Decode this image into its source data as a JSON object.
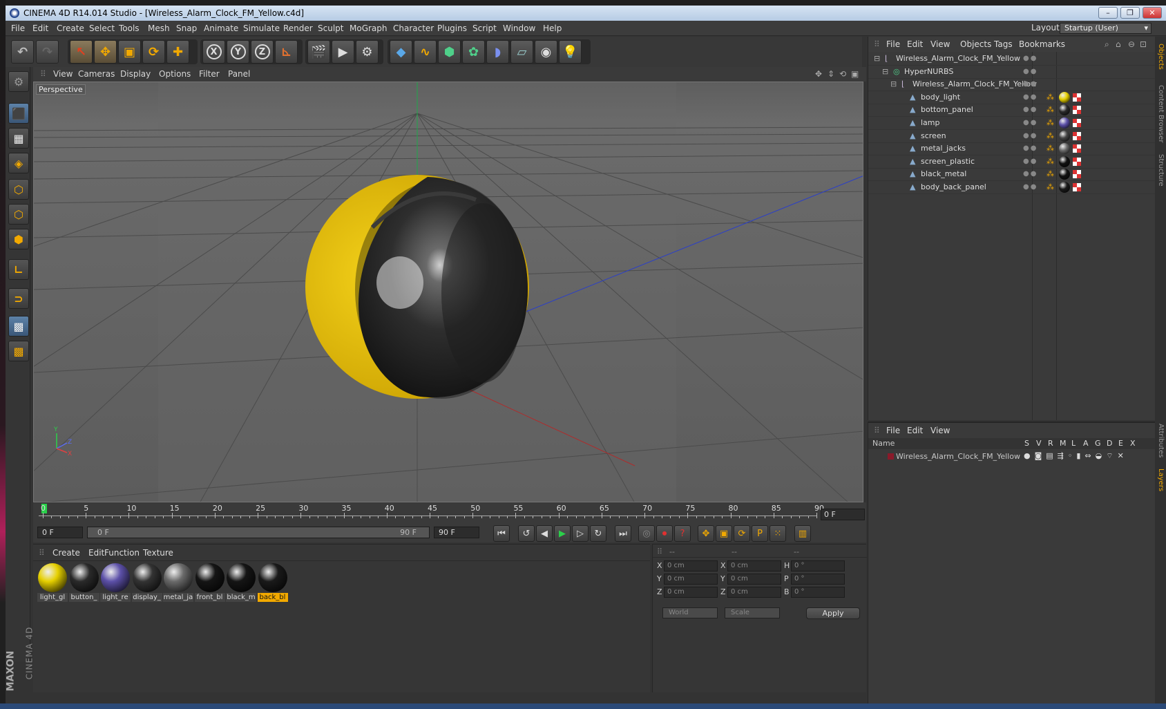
{
  "window": {
    "title": "CINEMA 4D R14.014 Studio - [Wireless_Alarm_Clock_FM_Yellow.c4d]",
    "controls": [
      "–",
      "❐",
      "✕"
    ]
  },
  "menubar": {
    "items": [
      "File",
      "Edit",
      "Create",
      "Select",
      "Tools",
      "Mesh",
      "Snap",
      "Animate",
      "Simulate",
      "Render",
      "Sculpt",
      "MoGraph",
      "Character",
      "Plugins",
      "Script",
      "Window",
      "Help"
    ],
    "layout_label": "Layout:",
    "layout_value": "Startup (User)"
  },
  "toolbar": {
    "axis_x": "X",
    "axis_y": "Y",
    "axis_z": "Z"
  },
  "viewport": {
    "menu": [
      "View",
      "Cameras",
      "Display",
      "Options",
      "Filter",
      "Panel"
    ],
    "label": "Perspective",
    "axis_labels": {
      "y": "Y",
      "z": "Z",
      "x": "X"
    }
  },
  "timeline": {
    "ticks": [
      "0",
      "5",
      "10",
      "15",
      "20",
      "25",
      "30",
      "35",
      "40",
      "45",
      "50",
      "55",
      "60",
      "65",
      "70",
      "75",
      "80",
      "85",
      "90"
    ],
    "current_frame": "0 F",
    "start_field": "0 F",
    "range_start": "0 F",
    "range_end": "90 F",
    "end_field": "90 F"
  },
  "material_manager": {
    "menu": [
      "Create",
      "Edit",
      "Function",
      "Texture"
    ],
    "materials": [
      {
        "label": "light_gl",
        "color": "#e6d000"
      },
      {
        "label": "button_",
        "color": "#2a2a2a"
      },
      {
        "label": "light_re",
        "color": "#5c50a8"
      },
      {
        "label": "display_",
        "color": "#333333"
      },
      {
        "label": "metal_ja",
        "color": "#6a6a6a"
      },
      {
        "label": "front_bl",
        "color": "#151515"
      },
      {
        "label": "black_m",
        "color": "#151515"
      },
      {
        "label": "back_bl",
        "color": "#1a1a1a",
        "selected": true
      }
    ]
  },
  "coordinates": {
    "headers": [
      "--",
      "--",
      "--"
    ],
    "rows": [
      {
        "a": "X",
        "av": "0 cm",
        "b": "X",
        "bv": "0 cm",
        "c": "H",
        "cv": "0 °"
      },
      {
        "a": "Y",
        "av": "0 cm",
        "b": "Y",
        "bv": "0 cm",
        "c": "P",
        "cv": "0 °"
      },
      {
        "a": "Z",
        "av": "0 cm",
        "b": "Z",
        "bv": "0 cm",
        "c": "B",
        "cv": "0 °"
      }
    ],
    "mode1": "World",
    "mode2": "Scale",
    "apply": "Apply"
  },
  "object_manager": {
    "menu": [
      "File",
      "Edit",
      "View",
      "Objects",
      "Tags",
      "Bookmarks"
    ],
    "objects": [
      {
        "name": "Wireless_Alarm_Clock_FM_Yellow",
        "indent": 0,
        "type": "null"
      },
      {
        "name": "HyperNURBS",
        "indent": 1,
        "type": "nurbs"
      },
      {
        "name": "Wireless_Alarm_Clock_FM_Yellow",
        "indent": 2,
        "type": "null"
      },
      {
        "name": "body_light",
        "indent": 3,
        "type": "poly",
        "tag": "#e6d000"
      },
      {
        "name": "bottom_panel",
        "indent": 3,
        "type": "poly",
        "tag": "#2a2a2a"
      },
      {
        "name": "lamp",
        "indent": 3,
        "type": "poly",
        "tag": "#5c50a8"
      },
      {
        "name": "screen",
        "indent": 3,
        "type": "poly",
        "tag": "#444444"
      },
      {
        "name": "metal_jacks",
        "indent": 3,
        "type": "poly",
        "tag": "#6a6a6a"
      },
      {
        "name": "screen_plastic",
        "indent": 3,
        "type": "poly",
        "tag": "#111111"
      },
      {
        "name": "black_metal",
        "indent": 3,
        "type": "poly",
        "tag": "#111111"
      },
      {
        "name": "body_back_panel",
        "indent": 3,
        "type": "poly",
        "tag": "#1a1a1a"
      }
    ]
  },
  "layer_manager": {
    "menu": [
      "File",
      "Edit",
      "View"
    ],
    "header_name": "Name",
    "columns": [
      "S",
      "V",
      "R",
      "M",
      "L",
      "A",
      "G",
      "D",
      "E",
      "X"
    ],
    "layers": [
      {
        "name": "Wireless_Alarm_Clock_FM_Yellow",
        "color": "#8a1a2a"
      }
    ]
  },
  "side_tabs": [
    "Objects",
    "Content Browser",
    "Structure",
    "Attributes",
    "Layers"
  ],
  "brand": {
    "maxon": "MAXON",
    "product": "CINEMA 4D"
  }
}
